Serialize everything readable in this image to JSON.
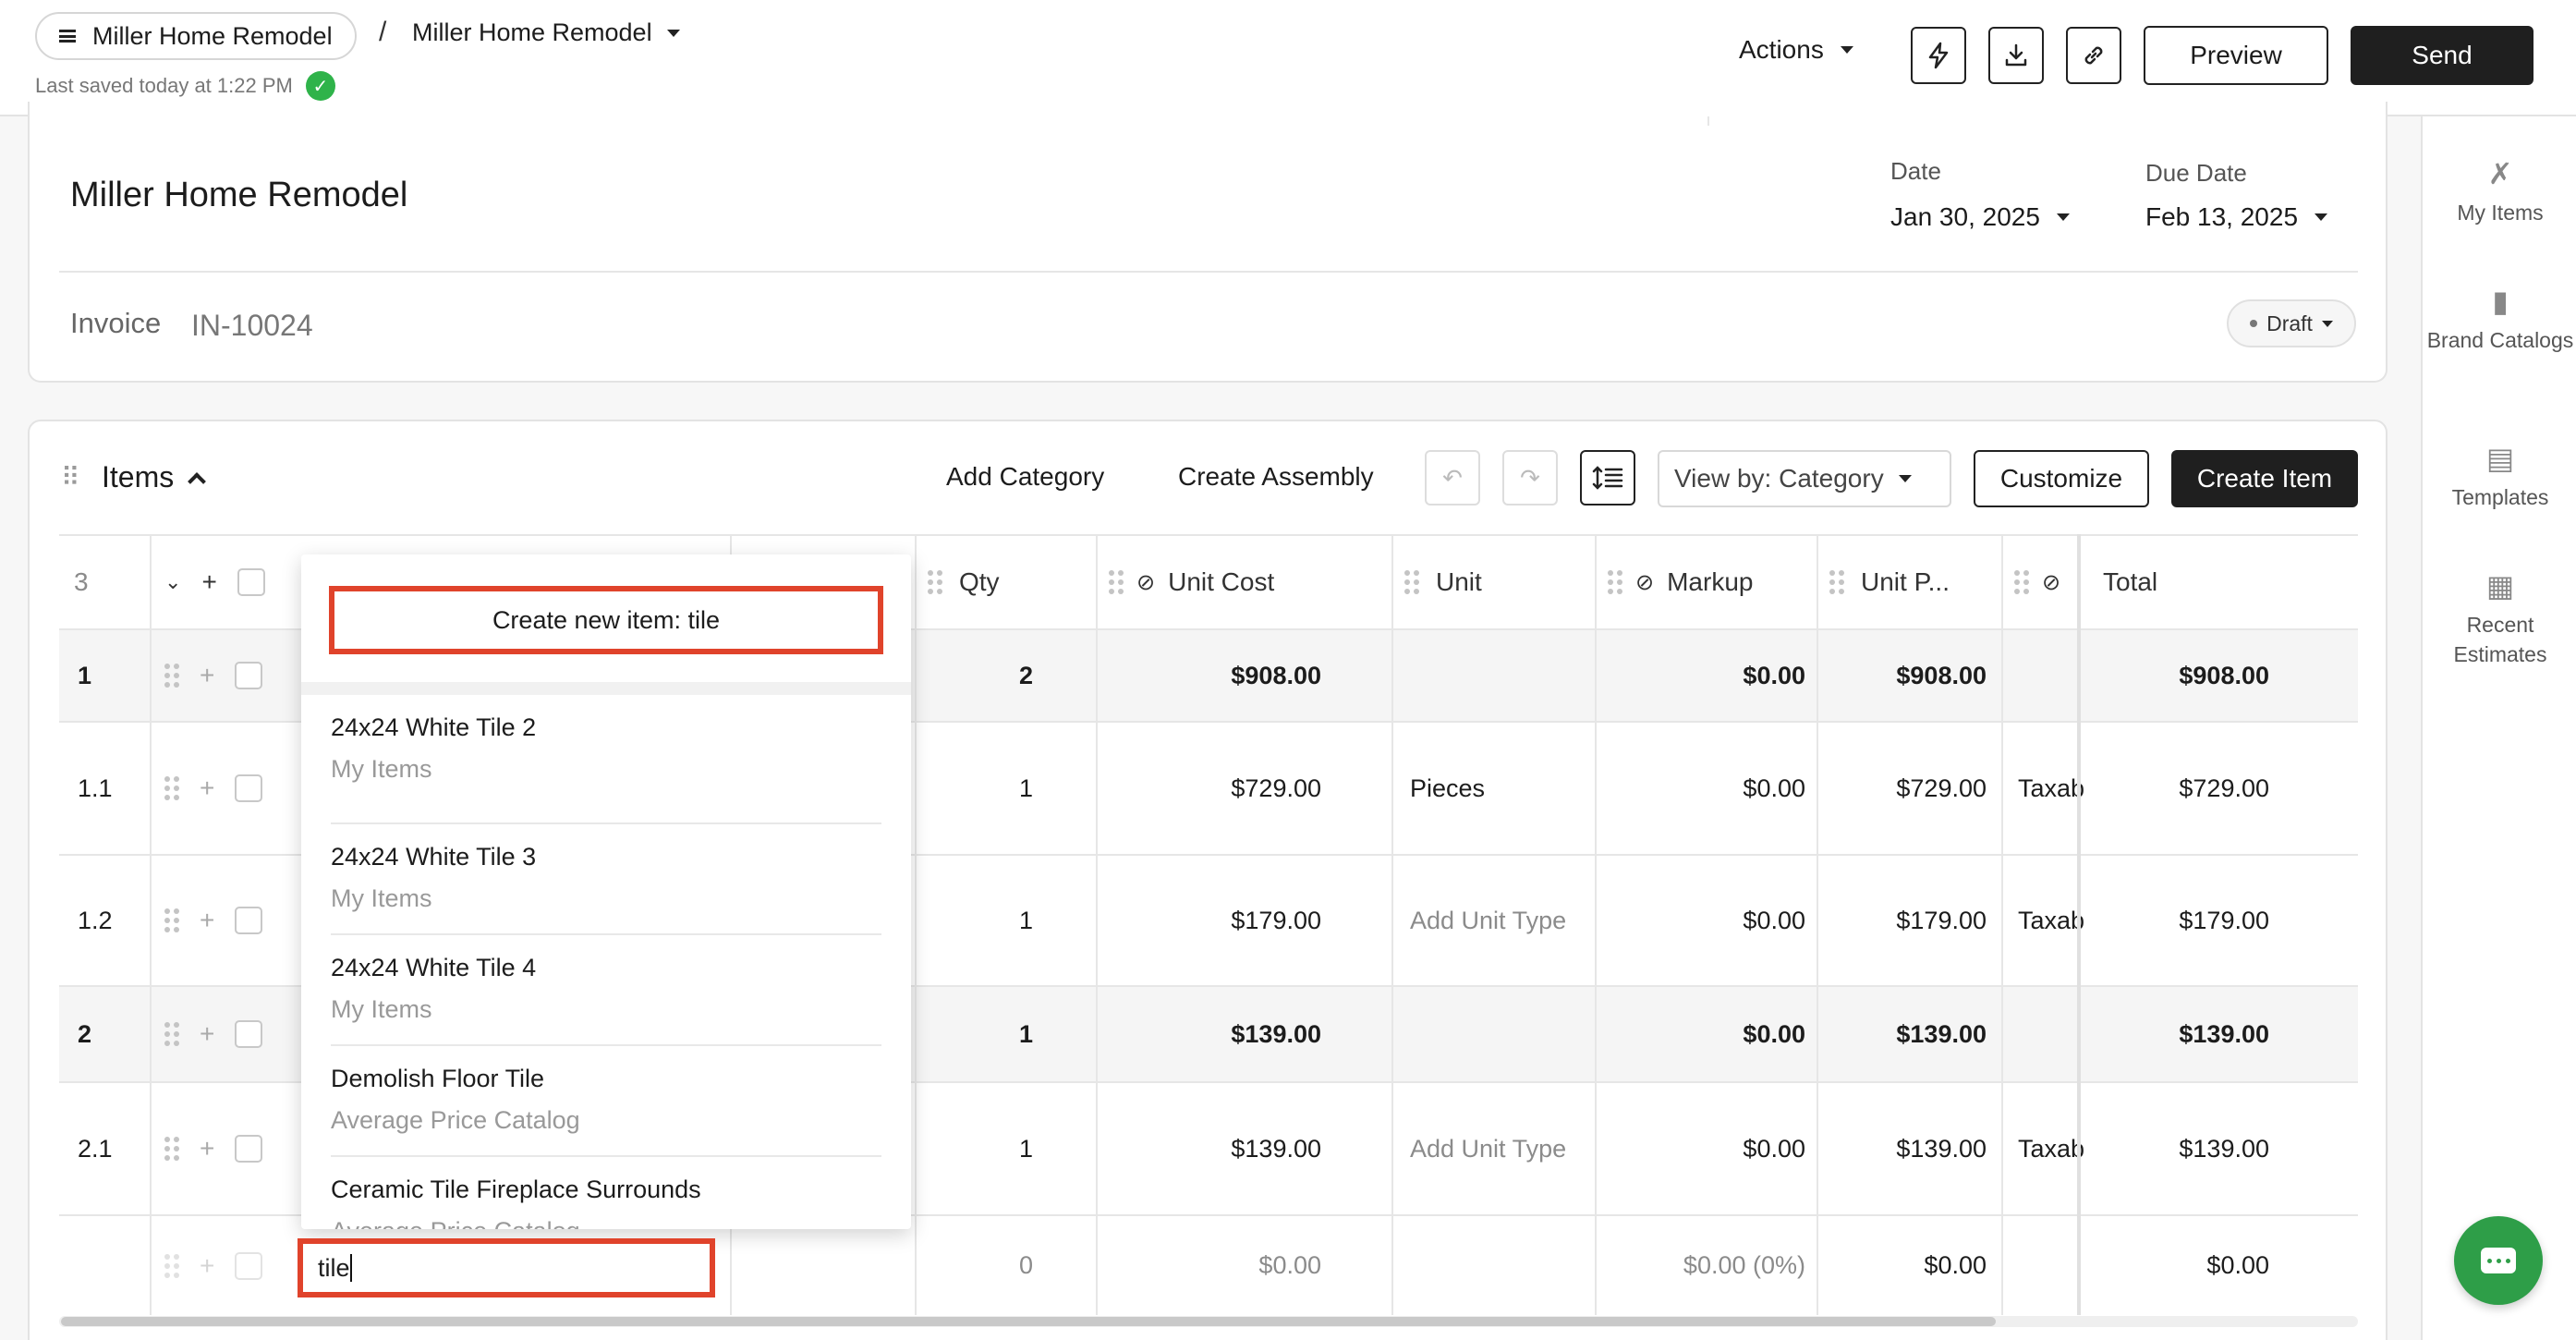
{
  "breadcrumb": {
    "project": "Miller Home Remodel",
    "current": "Miller Home Remodel"
  },
  "saved_status": "Last saved today at 1:22 PM",
  "topbar": {
    "actions_label": "Actions",
    "preview_label": "Preview",
    "send_label": "Send"
  },
  "sidebar": {
    "items": [
      {
        "label": "My Items",
        "icon": "tools-icon"
      },
      {
        "label": "Brand Catalogs",
        "icon": "book-icon"
      },
      {
        "label": "Templates",
        "icon": "clipboard-icon"
      },
      {
        "label": "Recent Estimates",
        "icon": "calculator-icon"
      }
    ]
  },
  "document": {
    "title": "Miller Home Remodel",
    "date_label": "Date",
    "date_value": "Jan 30, 2025",
    "due_label": "Due Date",
    "due_value": "Feb 13, 2025",
    "type_label": "Invoice",
    "number": "IN-10024",
    "status": "Draft"
  },
  "items_section": {
    "title": "Items",
    "add_category": "Add Category",
    "create_assembly": "Create Assembly",
    "view_by": "View by: Category",
    "customize": "Customize",
    "create_item": "Create Item"
  },
  "table": {
    "count": "3",
    "columns": {
      "qty": "Qty",
      "unit_cost": "Unit Cost",
      "unit": "Unit",
      "markup": "Markup",
      "unit_price": "Unit P...",
      "total": "Total"
    },
    "rows": [
      {
        "num": "1",
        "qty": "2",
        "unit_cost": "$908.00",
        "unit": "",
        "markup": "$0.00",
        "unit_price": "$908.00",
        "tax": "",
        "total": "$908.00",
        "category": true
      },
      {
        "num": "1.1",
        "qty": "1",
        "unit_cost": "$729.00",
        "unit": "Pieces",
        "markup": "$0.00",
        "unit_price": "$729.00",
        "tax": "Taxab",
        "total": "$729.00",
        "category": false
      },
      {
        "num": "1.2",
        "qty": "1",
        "unit_cost": "$179.00",
        "unit": "Add Unit Type",
        "markup": "$0.00",
        "unit_price": "$179.00",
        "tax": "Taxab",
        "total": "$179.00",
        "category": false
      },
      {
        "num": "2",
        "qty": "1",
        "unit_cost": "$139.00",
        "unit": "",
        "markup": "$0.00",
        "unit_price": "$139.00",
        "tax": "",
        "total": "$139.00",
        "category": true
      },
      {
        "num": "2.1",
        "qty": "1",
        "unit_cost": "$139.00",
        "unit": "Add Unit Type",
        "markup": "$0.00",
        "unit_price": "$139.00",
        "tax": "Taxab",
        "total": "$139.00",
        "category": false
      }
    ],
    "new_row": {
      "input_value": "tile",
      "qty": "0",
      "unit_cost": "$0.00",
      "markup": "$0.00 (0%)",
      "unit_price": "$0.00",
      "total": "$0.00"
    }
  },
  "suggestions": {
    "create_new": "Create new item: tile",
    "options": [
      {
        "name": "24x24 White Tile 2",
        "source": "My Items"
      },
      {
        "name": "24x24 White Tile 3",
        "source": "My Items"
      },
      {
        "name": "24x24 White Tile 4",
        "source": "My Items"
      },
      {
        "name": "Demolish Floor Tile",
        "source": "Average Price Catalog"
      },
      {
        "name": "Ceramic Tile Fireplace Surrounds",
        "source": "Average Price Catalog"
      }
    ]
  },
  "colors": {
    "highlight": "#e0432b",
    "success": "#2fb34a",
    "chat": "#2e9e48",
    "primary_dark": "#1f1f1f"
  }
}
